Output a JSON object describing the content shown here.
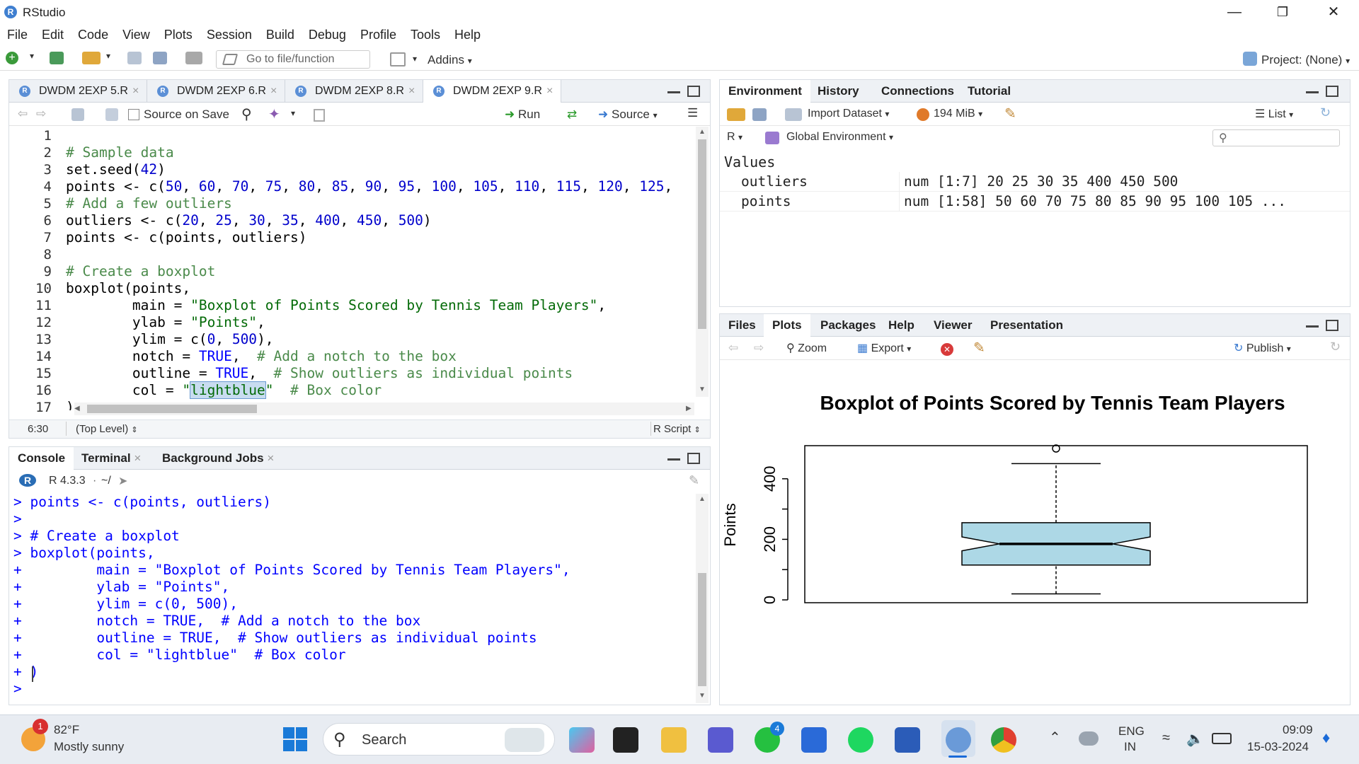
{
  "app": {
    "title": "RStudio",
    "logo": "R"
  },
  "menu": [
    "File",
    "Edit",
    "Code",
    "View",
    "Plots",
    "Session",
    "Build",
    "Debug",
    "Profile",
    "Tools",
    "Help"
  ],
  "toolbar": {
    "goto_placeholder": "Go to file/function",
    "addins": "Addins",
    "project": "Project: (None)"
  },
  "editor": {
    "tabs": [
      {
        "label": "DWDM 2EXP 5.R",
        "active": false
      },
      {
        "label": "DWDM 2EXP 6.R",
        "active": false
      },
      {
        "label": "DWDM 2EXP 8.R",
        "active": false
      },
      {
        "label": "DWDM 2EXP 9.R",
        "active": true
      }
    ],
    "source_on_save": "Source on Save",
    "run": "Run",
    "source": "Source",
    "line_numbers": [
      "1",
      "2",
      "3",
      "4",
      "5",
      "6",
      "7",
      "8",
      "9",
      "10",
      "11",
      "12",
      "13",
      "14",
      "15",
      "16",
      "17"
    ],
    "status_pos": "6:30",
    "status_level": "(Top Level)",
    "status_type": "R Script"
  },
  "console": {
    "tabs": [
      "Console",
      "Terminal",
      "Background Jobs"
    ],
    "version": "R 4.3.3",
    "path": "~/",
    "lines": [
      "> points <- c(points, outliers)",
      ">",
      "> # Create a boxplot",
      "> boxplot(points,",
      "+         main = \"Boxplot of Points Scored by Tennis Team Players\",",
      "+         ylab = \"Points\",",
      "+         ylim = c(0, 500),",
      "+         notch = TRUE,  # Add a notch to the box",
      "+         outline = TRUE,  # Show outliers as individual points",
      "+         col = \"lightblue\"  # Box color",
      "+ )",
      ">"
    ]
  },
  "environment": {
    "tabs": [
      "Environment",
      "History",
      "Connections",
      "Tutorial"
    ],
    "import_dataset": "Import Dataset",
    "memory": "194 MiB",
    "list": "List",
    "r_label": "R",
    "scope": "Global Environment",
    "section": "Values",
    "values": [
      {
        "name": "outliers",
        "value": "num [1:7] 20 25 30 35 400 450 500"
      },
      {
        "name": "points",
        "value": "num [1:58] 50 60 70 75 80 85 90 95 100 105 ..."
      }
    ]
  },
  "files": {
    "tabs": [
      "Files",
      "Plots",
      "Packages",
      "Help",
      "Viewer",
      "Presentation"
    ],
    "zoom": "Zoom",
    "export": "Export",
    "publish": "Publish"
  },
  "chart_data": {
    "type": "boxplot",
    "title": "Boxplot of Points Scored by Tennis Team Players",
    "ylabel": "Points",
    "ylim": [
      0,
      500
    ],
    "yticks": [
      "0",
      "200",
      "400"
    ],
    "box": {
      "whisker_low": 20,
      "q1": 115,
      "median": 185,
      "q3": 255,
      "whisker_high": 450,
      "notch_low": 162,
      "notch_high": 208,
      "color": "#add8e6"
    },
    "outliers": [
      500
    ]
  },
  "taskbar": {
    "weather_temp": "82°F",
    "weather_desc": "Mostly sunny",
    "weather_badge": "1",
    "search": "Search",
    "lang_top": "ENG",
    "lang_bottom": "IN",
    "time": "09:09",
    "date": "15-03-2024",
    "whatsapp_badge": "4"
  }
}
